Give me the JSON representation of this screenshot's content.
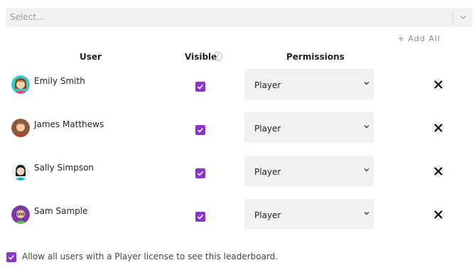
{
  "select": {
    "placeholder": "Select..."
  },
  "add_all_label": "+ Add All",
  "columns": {
    "user": "User",
    "visible": "Visible",
    "permissions": "Permissions"
  },
  "help_icon_glyph": "?",
  "users": [
    {
      "name": "Emily Smith",
      "visible": true,
      "permission": "Player",
      "avatar": "woman-teal"
    },
    {
      "name": "James Matthews",
      "visible": true,
      "permission": "Player",
      "avatar": "man-brown"
    },
    {
      "name": "Sally Simpson",
      "visible": true,
      "permission": "Player",
      "avatar": "woman-black-hair"
    },
    {
      "name": "Sam Sample",
      "visible": true,
      "permission": "Player",
      "avatar": "man-purple"
    }
  ],
  "footer": {
    "checked": true,
    "text": "Allow all users with a Player license to see this leaderboard."
  },
  "colors": {
    "accent": "#8a35c8",
    "field_bg": "#f1f1f1"
  }
}
